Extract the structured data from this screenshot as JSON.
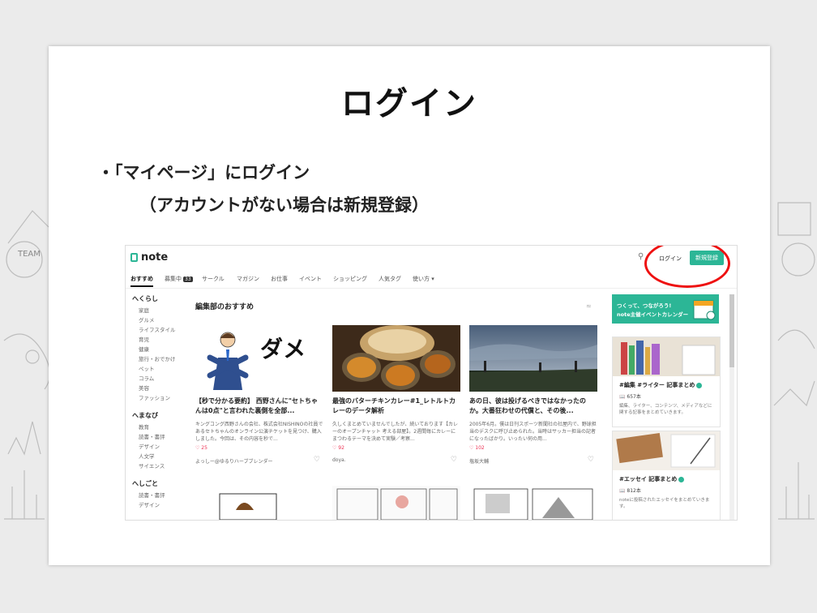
{
  "slide": {
    "title": "ログイン",
    "bullet": "・「マイページ」にログイン",
    "sub": "（アカウントがない場合は新規登録）"
  },
  "site": {
    "logo": "note",
    "login": "ログイン",
    "signup": "新規登録"
  },
  "nav": {
    "items": [
      "おすすめ",
      "募集中",
      "サークル",
      "マガジン",
      "お仕事",
      "イベント",
      "ショッピング",
      "人気タグ",
      "使い方 ▾"
    ],
    "badge": "33"
  },
  "sidebar": {
    "groups": [
      {
        "heading": "へくらし",
        "items": [
          "家庭",
          "グルメ",
          "ライフスタイル",
          "育児",
          "健康",
          "旅行・おでかけ",
          "ペット",
          "コラム",
          "美容",
          "ファッション"
        ]
      },
      {
        "heading": "へまなび",
        "items": [
          "教育",
          "読書・書評",
          "デザイン",
          "人文学",
          "サイエンス"
        ]
      },
      {
        "heading": "へしごと",
        "items": [
          "読書・書評",
          "デザイン"
        ]
      }
    ]
  },
  "main": {
    "section_title": "編集部のおすすめ",
    "dame": "ダメ",
    "cards": [
      {
        "title": "【秒で分かる要約】 西野さんに\"セトちゃんは0点\"と言われた裏側を全部...",
        "desc": "キングコング西野さんの会社、株式会社NISHINOの社員であるセトちゃんのオンライン公演チケットを見つけ、購入しました。今回は、その内容を秒で...",
        "likes": "♡ 25",
        "author": "よっしー@ゆるりハーブブレンダー"
      },
      {
        "title": "最強のバターチキンカレー#1_レトルトカレーのデータ解析",
        "desc": "久しくまとめていませんでしたが、続いております【カレーのオープンチャット 考える部屋】。2週間毎にカレーにまつわるテーマを決めて実験／考察...",
        "likes": "♡ 92",
        "author": "doya."
      },
      {
        "title": "あの日、彼は投げるべきではなかったのか。大番狂わせの代償と、その後...",
        "desc": "2005年6月。僕は日刊スポーツ新聞社の社屋内で、野球担当のデスクに呼び止められた。当時はサッカー担当の記者になったばかり。いったい何の用...",
        "likes": "♡ 102",
        "author": "塩坂大輔"
      }
    ]
  },
  "right": {
    "banner_line1": "つくって、つながろう!",
    "banner_line2": "note主催イベントカレンダー",
    "cards": [
      {
        "title": "#編集 #ライター 記事まとめ",
        "count": "657本",
        "desc": "編集、ライター、コンテンツ、メディアなどに関する記事をまとめていきます。"
      },
      {
        "title": "#エッセイ 記事まとめ",
        "count": "812本",
        "desc": "noteに投稿されたエッセイをまとめていきます。"
      }
    ]
  },
  "colors": {
    "brand": "#2cb696",
    "highlight": "#e11111"
  }
}
